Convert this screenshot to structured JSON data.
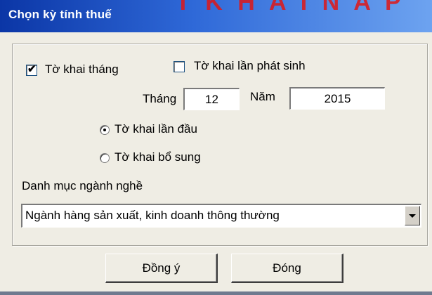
{
  "window": {
    "title": "Chọn kỳ tính thuế"
  },
  "declaration_type": {
    "monthly_label": "Tờ khai tháng",
    "monthly_checked": true,
    "incurred_label": "Tờ khai lần phát sinh",
    "incurred_checked": false
  },
  "period": {
    "month_label": "Tháng",
    "month_value": "12",
    "year_label": "Năm",
    "year_value": "2015"
  },
  "submission": {
    "first_label": "Tờ khai lần đầu",
    "supplement_label": "Tờ khai bổ sung",
    "selected": "first"
  },
  "industry": {
    "label": "Danh mục ngành nghề",
    "selected": "Ngành hàng sản xuất, kinh doanh thông thường"
  },
  "buttons": {
    "ok": "Đồng ý",
    "close": "Đóng"
  },
  "colors": {
    "title_bar": "#0b36a6",
    "dialog_bg": "#efede4",
    "background_text": "#e01717"
  },
  "icons": {
    "combo_arrow": "chevron-down-icon"
  }
}
